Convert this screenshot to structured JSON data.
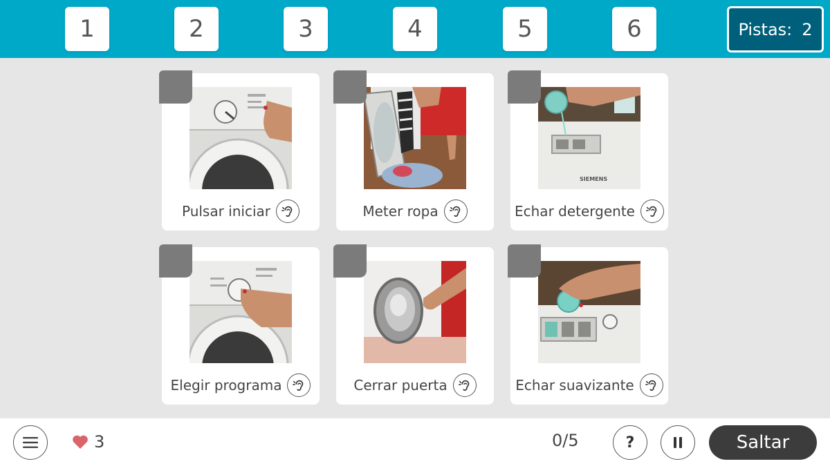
{
  "slots": [
    "1",
    "2",
    "3",
    "4",
    "5",
    "6"
  ],
  "hints": {
    "label": "Pistas:",
    "count": "2"
  },
  "cards": [
    {
      "label": "Pulsar iniciar"
    },
    {
      "label": "Meter ropa"
    },
    {
      "label": "Echar detergente"
    },
    {
      "label": "Elegir programa"
    },
    {
      "label": "Cerrar puerta"
    },
    {
      "label": "Echar suavizante"
    }
  ],
  "photo_text": {
    "brand": "SIEMENS"
  },
  "footer": {
    "lives": "3",
    "progress": "0/5",
    "help_label": "?",
    "skip_label": "Saltar"
  },
  "colors": {
    "topbar": "#00a9c8",
    "hints_bg": "#005f7a",
    "background": "#e6e6e6",
    "heart": "#d9646a",
    "skip_bg": "#3c3c3c"
  },
  "icons": [
    "ear-icon",
    "menu-icon",
    "heart-icon",
    "pause-icon"
  ]
}
